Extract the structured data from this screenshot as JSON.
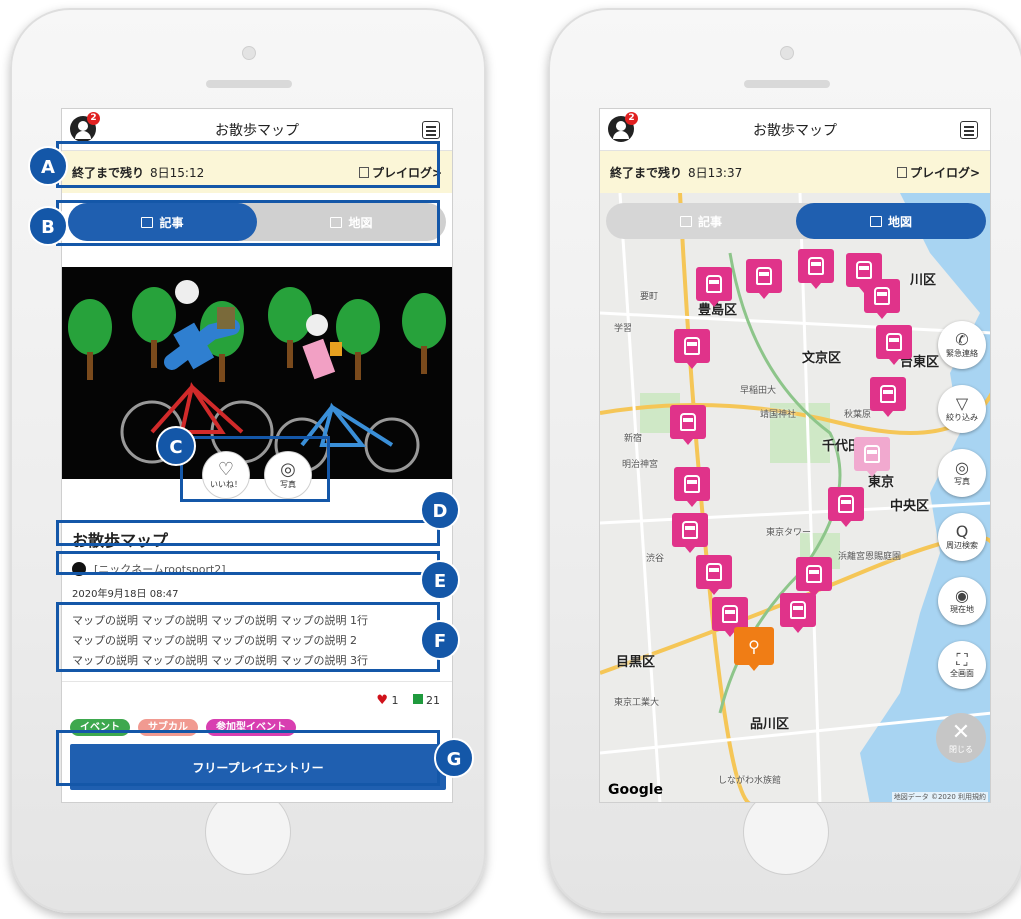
{
  "app": {
    "title": "お散歩マップ",
    "notification_count": "2"
  },
  "left_screen": {
    "timer_label": "終了まで残り",
    "timer_value": "8日15:12",
    "playlog_label": "プレイログ>",
    "tab_article": "記事",
    "tab_map": "地図",
    "like_label": "いいね！",
    "photo_label": "写真",
    "article_title": "お散歩マップ",
    "author": "[ニックネームrootsport2]",
    "date": "2020年9月18日 08:47",
    "description_lines": [
      "マップの説明 マップの説明 マップの説明 マップの説明 1行",
      "マップの説明 マップの説明 マップの説明 マップの説明 2",
      "マップの説明 マップの説明 マップの説明 マップの説明 3行"
    ],
    "like_count": "1",
    "comment_count": "21",
    "tags": [
      {
        "label": "イベント",
        "color": "#3ea84e"
      },
      {
        "label": "サブカル",
        "color": "#f19a91"
      },
      {
        "label": "参加型イベント",
        "color": "#d83fb1"
      }
    ],
    "entry_button": "フリープレイエントリー"
  },
  "annotations": [
    "A",
    "B",
    "C",
    "D",
    "E",
    "F",
    "G"
  ],
  "right_screen": {
    "timer_label": "終了まで残り",
    "timer_value": "8日13:37",
    "playlog_label": "プレイログ>",
    "tab_article": "記事",
    "tab_map": "地図",
    "side_buttons": [
      {
        "label": "緊急連絡",
        "icon": "phone-icon"
      },
      {
        "label": "絞り込み",
        "icon": "filter-icon"
      },
      {
        "label": "写真",
        "icon": "camera-icon"
      },
      {
        "label": "周辺検索",
        "icon": "search-icon"
      },
      {
        "label": "現在地",
        "icon": "location-icon"
      },
      {
        "label": "全画面",
        "icon": "fullscreen-icon"
      }
    ],
    "close_label": "閉じる",
    "map_labels": [
      "川区",
      "豊島区",
      "文京区",
      "早稲田大",
      "靖国神社",
      "秋葉原",
      "千代田",
      "明治神宮",
      "東京",
      "中央区",
      "東京タワー",
      "浜離宮恩賜庭園",
      "渋谷",
      "目黒区",
      "東京工業大",
      "品川区",
      "しながわ水族館",
      "要町",
      "学習",
      "新宿",
      "台東区"
    ],
    "google": "Google",
    "copyright": "地図データ ©2020 利用規約"
  },
  "colors": {
    "primary": "#1f5fb0",
    "annotation": "#1457a8",
    "timer_bg": "#fbf6d7",
    "pin": "#e0338a",
    "bike_pin": "#f07d15"
  }
}
